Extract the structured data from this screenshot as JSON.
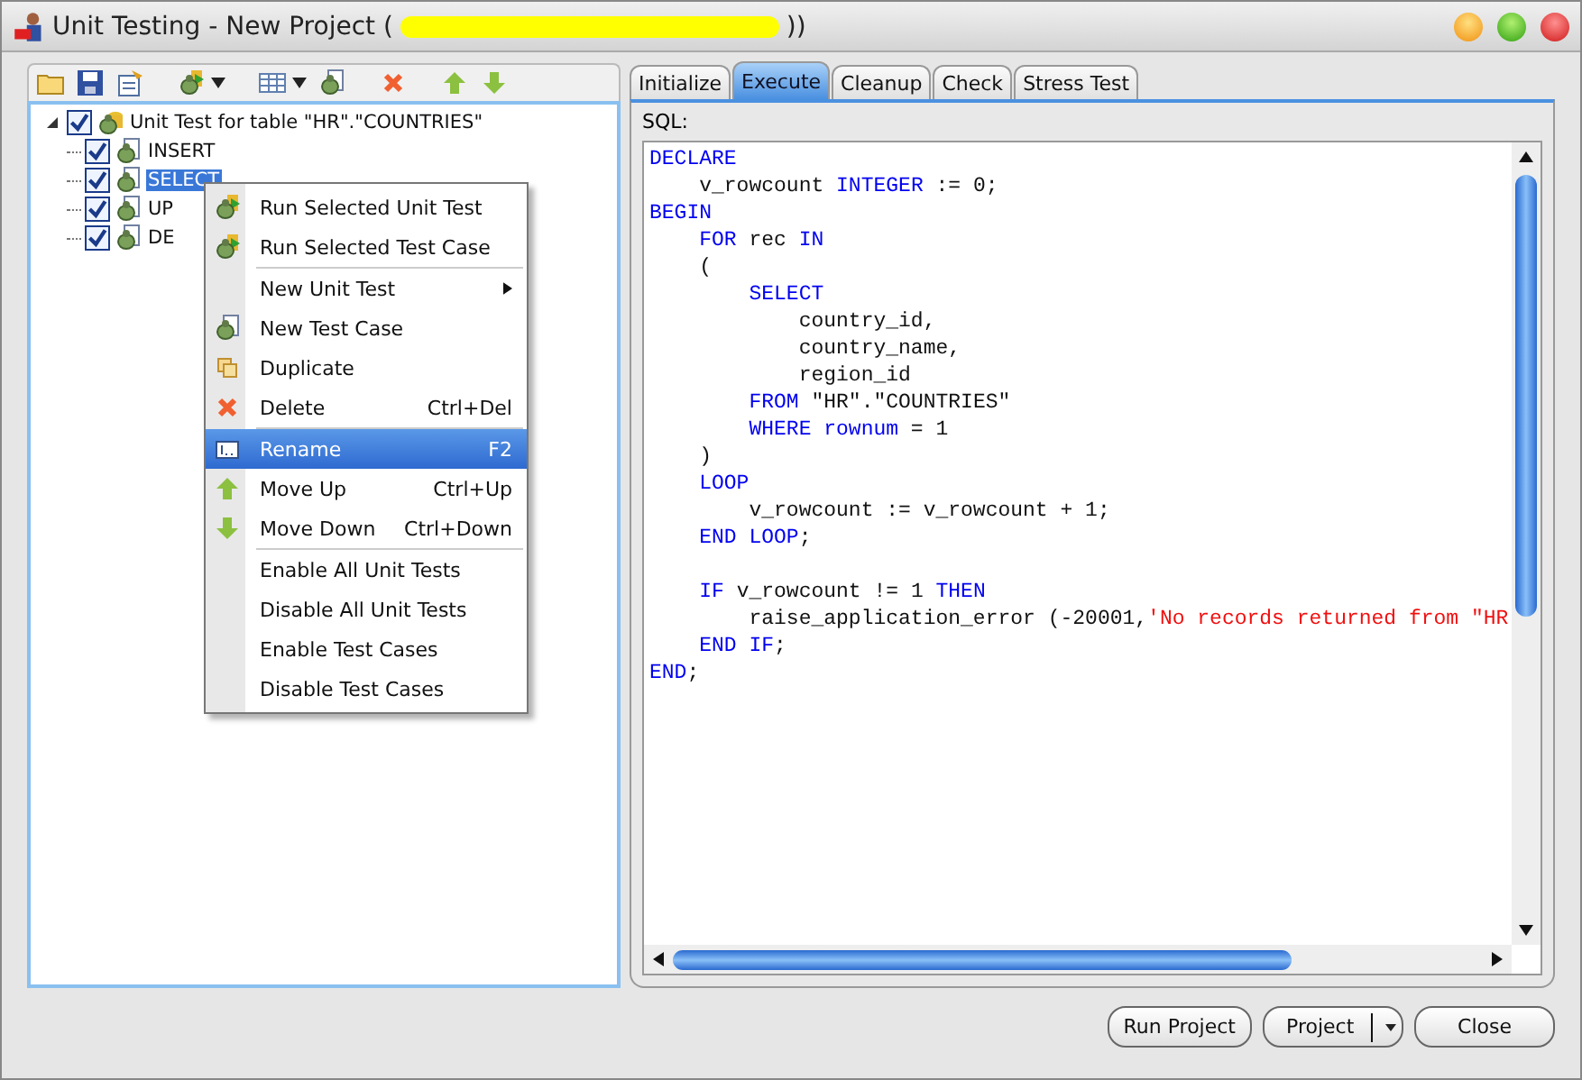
{
  "window": {
    "title": "Unit Testing - New Project (",
    "title_end": "))"
  },
  "tree": {
    "label": "Unit Test for table \"HR\".\"COUNTRIES\"",
    "checked": true,
    "expanded": true,
    "selected": false,
    "children": [
      {
        "label": "INSERT",
        "checked": true,
        "selected": false
      },
      {
        "label": "SELECT",
        "checked": true,
        "selected": true
      },
      {
        "label": "UP",
        "checked": true,
        "selected": false
      },
      {
        "label": "DE",
        "checked": true,
        "selected": false
      }
    ]
  },
  "context_menu": [
    {
      "kind": "item",
      "label": "Run Selected Unit Test",
      "selected": false
    },
    {
      "kind": "item",
      "label": "Run Selected Test Case",
      "selected": false
    },
    {
      "kind": "separator"
    },
    {
      "kind": "submenu",
      "label": "New Unit Test",
      "selected": false
    },
    {
      "kind": "item",
      "label": "New Test Case",
      "selected": false
    },
    {
      "kind": "item",
      "label": "Duplicate",
      "selected": false
    },
    {
      "kind": "item",
      "label": "Delete",
      "shortcut": "Ctrl+Del",
      "selected": false
    },
    {
      "kind": "separator"
    },
    {
      "kind": "item",
      "label": "Rename",
      "shortcut": "F2",
      "selected": true
    },
    {
      "kind": "item",
      "label": "Move Up",
      "shortcut": "Ctrl+Up",
      "selected": false
    },
    {
      "kind": "item",
      "label": "Move Down",
      "shortcut": "Ctrl+Down",
      "selected": false
    },
    {
      "kind": "separator"
    },
    {
      "kind": "item",
      "label": "Enable All Unit Tests",
      "selected": false
    },
    {
      "kind": "item",
      "label": "Disable All Unit Tests",
      "selected": false
    },
    {
      "kind": "item",
      "label": "Enable Test Cases",
      "selected": false
    },
    {
      "kind": "item",
      "label": "Disable Test Cases",
      "selected": false
    }
  ],
  "tabs": [
    {
      "label": "Initialize",
      "selected": false
    },
    {
      "label": "Execute",
      "selected": true
    },
    {
      "label": "Cleanup",
      "selected": false
    },
    {
      "label": "Check",
      "selected": false
    },
    {
      "label": "Stress Test",
      "selected": false
    }
  ],
  "sql_label": "SQL:",
  "code": [
    [
      {
        "kind": "kw",
        "text": "DECLARE"
      }
    ],
    [
      {
        "kind": "txt",
        "text": "    v_rowcount "
      },
      {
        "kind": "kw",
        "text": "INTEGER"
      },
      {
        "kind": "txt",
        "text": " := 0;"
      }
    ],
    [
      {
        "kind": "kw",
        "text": "BEGIN"
      }
    ],
    [
      {
        "kind": "kw",
        "text": "    FOR"
      },
      {
        "kind": "txt",
        "text": " rec "
      },
      {
        "kind": "kw",
        "text": "IN"
      }
    ],
    [
      {
        "kind": "txt",
        "text": "    ("
      }
    ],
    [
      {
        "kind": "kw",
        "text": "        SELECT"
      }
    ],
    [
      {
        "kind": "txt",
        "text": "            country_id,"
      }
    ],
    [
      {
        "kind": "txt",
        "text": "            country_name,"
      }
    ],
    [
      {
        "kind": "txt",
        "text": "            region_id"
      }
    ],
    [
      {
        "kind": "kw",
        "text": "        FROM"
      },
      {
        "kind": "txt",
        "text": " \"HR\".\"COUNTRIES\""
      }
    ],
    [
      {
        "kind": "kw",
        "text": "        WHERE rownum"
      },
      {
        "kind": "txt",
        "text": " = 1"
      }
    ],
    [
      {
        "kind": "txt",
        "text": "    )"
      }
    ],
    [
      {
        "kind": "kw",
        "text": "    LOOP"
      }
    ],
    [
      {
        "kind": "txt",
        "text": "        v_rowcount := v_rowcount + 1;"
      }
    ],
    [
      {
        "kind": "kw",
        "text": "    END LOOP"
      },
      {
        "kind": "txt",
        "text": ";"
      }
    ],
    [
      {
        "kind": "blank"
      }
    ],
    [
      {
        "kind": "kw",
        "text": "    IF"
      },
      {
        "kind": "txt",
        "text": " v_rowcount != 1 "
      },
      {
        "kind": "kw",
        "text": "THEN"
      }
    ],
    [
      {
        "kind": "txt",
        "text": "        raise_application_error (-20001,"
      },
      {
        "kind": "str",
        "text": "'No records returned from \"HR"
      }
    ],
    [
      {
        "kind": "kw",
        "text": "    END IF"
      },
      {
        "kind": "txt",
        "text": ";"
      }
    ],
    [
      {
        "kind": "kw",
        "text": "END"
      },
      {
        "kind": "txt",
        "text": ";"
      }
    ]
  ],
  "buttons": [
    {
      "label": "Run Project",
      "kind": "plain"
    },
    {
      "label": "Project",
      "kind": "split"
    },
    {
      "label": "Close",
      "kind": "plain"
    }
  ]
}
